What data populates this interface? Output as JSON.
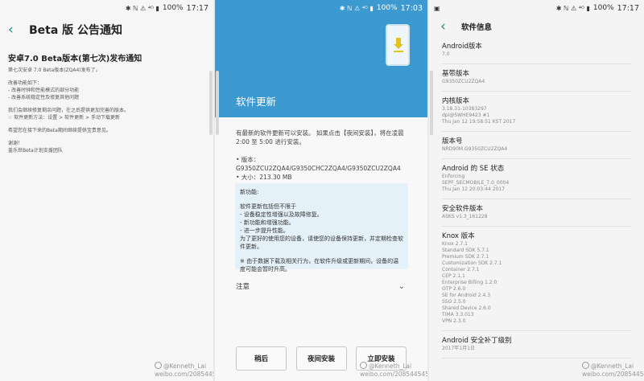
{
  "panel1": {
    "status": {
      "icons": "✱ ℕ ⚠ ⁴ᴳ ▮",
      "battery": "100%",
      "time": "17:17"
    },
    "header_title": "Beta 版 公告通知",
    "heading": "安卓7.0 Beta版本(第七次)发布通知",
    "body_lines": [
      "第七次安卓 7.0 Beta版本(ZQA4)发布了。",
      "",
      "改善功能如下：",
      " - 改善时钟和性能模式的部分功能",
      " - 改善系统稳定性及修复其他问题",
      "",
      "我们会继续修复剩余问题，在之后提供更加完善的版本。",
      " ☞ 软件更新方法：设置 > 软件更新 > 手动下载更新",
      "",
      "希望您在接下来的Beta期间继续提供宝贵意见。",
      "",
      "谢谢！",
      "盖乐世Beta计划支援团队"
    ],
    "watermark_line1": "@Kenneth_Lai",
    "watermark_line2": "weibo.com/208544545"
  },
  "panel2": {
    "status": {
      "icons": "✱ ℕ ⚠ ⁴ᴳ ▮",
      "battery": "100%",
      "time": "17:03"
    },
    "title": "软件更新",
    "intro": "有最新的软件更新可以安装。 如果点击【夜间安装】，将在凌晨 2:00 至 5:00 进行安装。",
    "version": "• 版本：G9350ZCU2ZQA4/G9350CHC2ZQA4/G9350ZCU2ZQA4",
    "size": "• 大小：213.30 MB",
    "notes_title": "新功能:",
    "notes_lines": [
      "软件更新包括但不限于",
      "- 设备稳定性增强以及故障修复。",
      "- 新功能和增强功能。",
      "- 进一步提升性能。",
      "为了更好的使用您的设备，请使您的设备保持更新，并定期检查软件更新。"
    ],
    "notes_warning": "※ 由于数据下载及相关行为，在软件升级或更新期间，设备的温度可能会暂时升高。",
    "attention_label": "注意",
    "buttons": {
      "later": "稍后",
      "night": "夜间安装",
      "now": "立即安装"
    },
    "watermark_line1": "@Kenneth_Lai",
    "watermark_line2": "weibo.com/208544545"
  },
  "panel3": {
    "status": {
      "icons": "✱ ℕ ⚠ ⁴ᴳ ▮",
      "battery": "100%",
      "time": "17:17"
    },
    "header_title": "软件信息",
    "items": [
      {
        "label": "Android版本",
        "value": "7.0"
      },
      {
        "label": "基带版本",
        "value": "G9350ZCU2ZQA4"
      },
      {
        "label": "内核版本",
        "value": "3.18.31-10383297\ndpi@SWHE9423 #1\nThu Jan 12 19:58:51 KST 2017"
      },
      {
        "label": "版本号",
        "value": "NRD90M.G9350ZCU2ZQA4"
      },
      {
        "label": "Android 的 SE 状态",
        "value": "Enforcing\nSEPF_SECMOBILE_7.0_0004\nThu Jan 12 20:03:44 2017"
      },
      {
        "label": "安全软件版本",
        "value": "ASKS v1.3_161228"
      },
      {
        "label": "Knox 版本",
        "value": "Knox 2.7.1\nStandard SDK 5.7.1\nPremium SDK 2.7.1\nCustomization SDK 2.7.1\nContainer 2.7.1\nCEP 2.1.1\nEnterprise Billing 1.2.0\nOTP 2.6.0\nSE for Android 2.4.3\nSSO 2.5.0\nShared Device 2.6.0\nTIMA 3.3.013\nVPN 2.3.0"
      },
      {
        "label": "Android 安全补丁级别",
        "value": "2017年1月1日"
      }
    ],
    "watermark_line1": "@Kenneth_Lai",
    "watermark_line2": "weibo.com/208544545"
  }
}
